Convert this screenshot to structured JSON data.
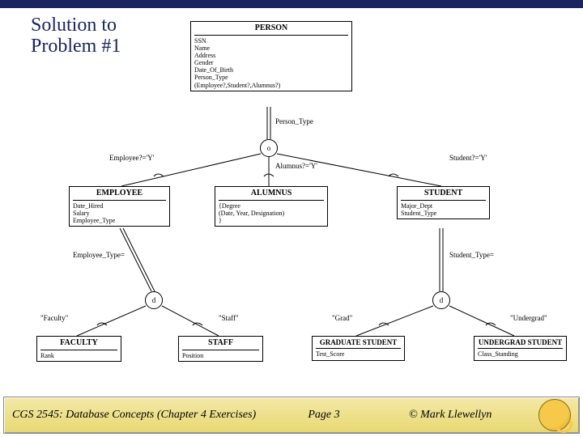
{
  "title": "Solution to Problem #1",
  "entities": {
    "person": {
      "name": "PERSON",
      "attrs": "SSN\nName\nAddress\nGender\nDate_Of_Birth\nPerson_Type\n(Employee?,Student?,Alumnus?)"
    },
    "employee": {
      "name": "EMPLOYEE",
      "attrs": "Date_Hired\nSalary\nEmployee_Type"
    },
    "alumnus": {
      "name": "ALUMNUS",
      "attrs": "{Degree\n(Date, Year, Designation)\n}"
    },
    "student": {
      "name": "STUDENT",
      "attrs": "Major_Dept\nStudent_Type"
    },
    "faculty": {
      "name": "FACULTY",
      "attrs": "Rank"
    },
    "staff": {
      "name": "STAFF",
      "attrs": "Position"
    },
    "grad": {
      "name": "GRADUATE STUDENT",
      "attrs": "Test_Score"
    },
    "undergrad": {
      "name": "UNDERGRAD STUDENT",
      "attrs": "Class_Standing"
    }
  },
  "specialization": {
    "person_circle": "o",
    "employee_circle": "d",
    "student_circle": "d"
  },
  "predicates": {
    "person_type": "Person_Type",
    "employee_y": "Employee?='Y'",
    "alumnus_y": "Alumnus?='Y'",
    "student_y": "Student?='Y'",
    "employee_type": "Employee_Type=",
    "student_type": "Student_Type=",
    "faculty": "\"Faculty\"",
    "staff": "\"Staff\"",
    "grad": "\"Grad\"",
    "undergrad": "\"Undergrad\""
  },
  "footer": {
    "left": "CGS 2545: Database Concepts  (Chapter 4 Exercises)",
    "mid": "Page 3",
    "right": "© Mark Llewellyn"
  }
}
